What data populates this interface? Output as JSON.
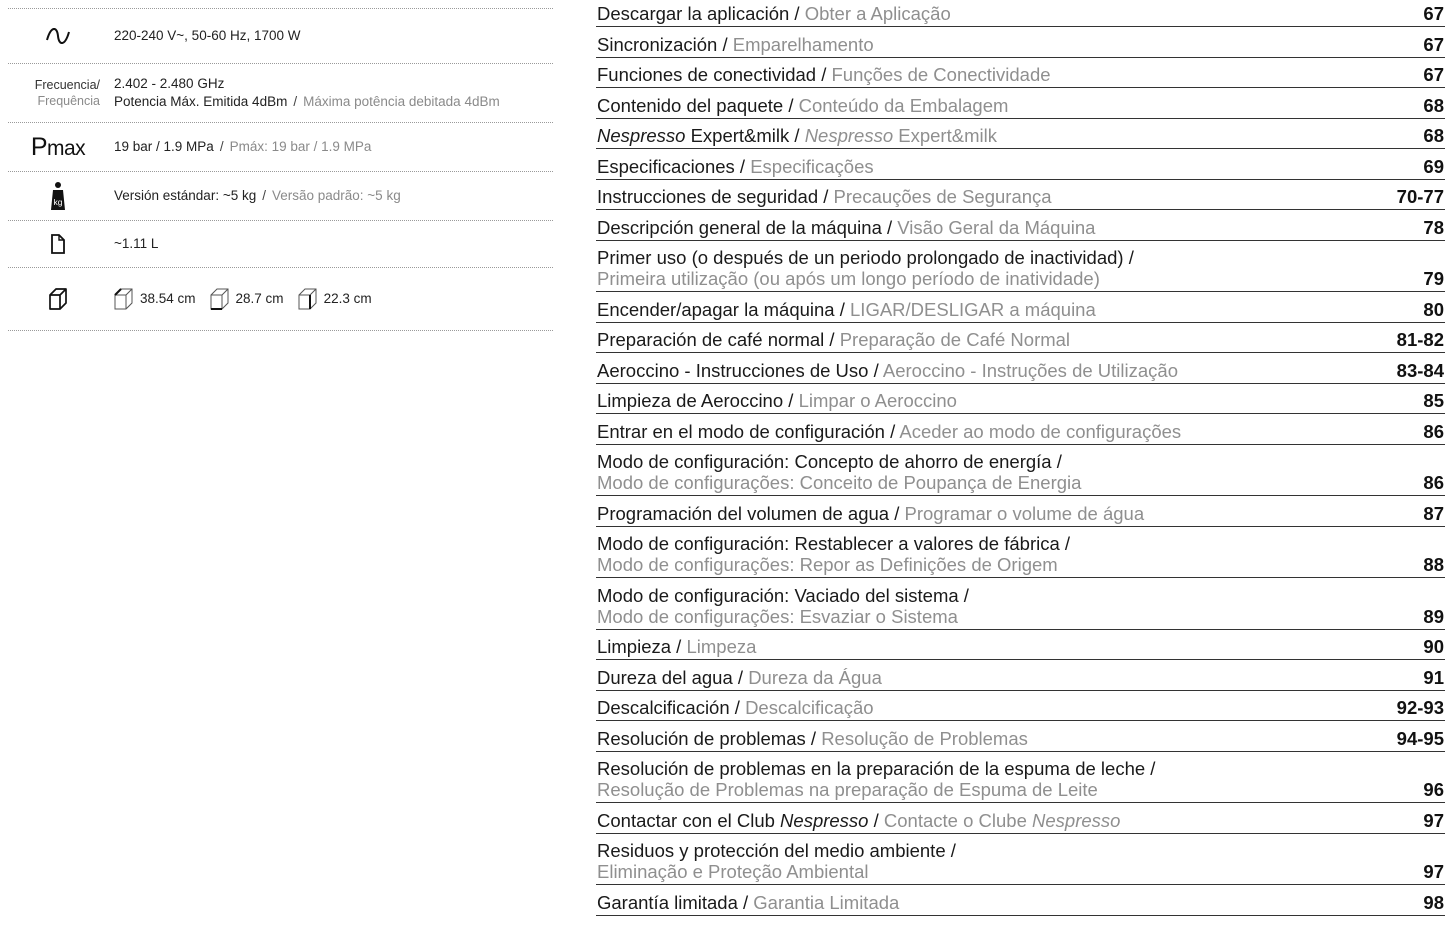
{
  "specs": {
    "voltage": "220-240 V~, 50-60 Hz, 1700 W",
    "frequency_label_es": "Frecuencia/",
    "frequency_label_pt": "Frequência",
    "frequency_value": "2.402 - 2.480 GHz",
    "power_es": "Potencia Máx. Emitida 4dBm",
    "power_pt": "Máxima potência debitada 4dBm",
    "pmax_symbol_p": "P",
    "pmax_symbol_max": "max",
    "pressure_es": "19 bar / 1.9 MPa",
    "pressure_pt": "Pmáx: 19 bar / 1.9 MPa",
    "weight_es": "Versión estándar: ~5 kg",
    "weight_pt": "Versão padrão: ~5 kg",
    "weight_icon_text": "kg",
    "capacity": "~1.11 L",
    "depth": "38.54 cm",
    "width": "28.7 cm",
    "height": "22.3 cm",
    "separator": "/"
  },
  "toc": [
    {
      "es": "Descargar la aplicación",
      "pt": "Obter a Aplicação",
      "page": "67"
    },
    {
      "es": "Sincronización",
      "pt": "Emparelhamento",
      "page": "67"
    },
    {
      "es": "Funciones de conectividad",
      "pt": "Funções de Conectividade",
      "page": "67"
    },
    {
      "es": "Contenido del paquete",
      "pt": "Conteúdo da Embalagem",
      "page": "68"
    },
    {
      "es_brand": "Nespresso",
      "es": " Expert&milk",
      "pt_brand": "Nespresso",
      "pt": " Expert&milk",
      "page": "68"
    },
    {
      "es": "Especificaciones",
      "pt": "Especificações",
      "page": "69"
    },
    {
      "es": "Instrucciones de seguridad",
      "pt": "Precauções de Segurança",
      "page": "70-77"
    },
    {
      "es": "Descripción general de la máquina",
      "pt": "Visão Geral da Máquina",
      "page": "78"
    },
    {
      "es": "Primer uso (o después de un periodo prolongado de inactividad) /",
      "pt": "Primeira utilização (ou após um longo período de inatividade)",
      "page": "79",
      "double": true
    },
    {
      "es": "Encender/apagar la máquina",
      "pt": "LIGAR/DESLIGAR a máquina",
      "page": "80"
    },
    {
      "es": "Preparación de café normal",
      "pt": "Preparação de Café Normal",
      "page": "81-82"
    },
    {
      "es": "Aeroccino - Instrucciones de Uso",
      "pt": "Aeroccino - Instruções de Utilização",
      "page": "83-84"
    },
    {
      "es": "Limpieza de Aeroccino",
      "pt": "Limpar o Aeroccino",
      "page": "85"
    },
    {
      "es": "Entrar en el modo de configuración",
      "pt": "Aceder ao modo de configurações",
      "page": "86"
    },
    {
      "es": "Modo de configuración: Concepto de ahorro de energía /",
      "pt": "Modo de configurações: Conceito de Poupança de Energia",
      "page": "86",
      "double": true
    },
    {
      "es": "Programación del volumen de agua",
      "pt": "Programar o volume de água",
      "page": "87"
    },
    {
      "es": "Modo de configuración: Restablecer a valores de fábrica /",
      "pt": "Modo de configurações: Repor as Definições de Origem",
      "page": "88",
      "double": true
    },
    {
      "es": "Modo de configuración: Vaciado del sistema /",
      "pt": "Modo de configurações: Esvaziar o Sistema",
      "page": "89",
      "double": true
    },
    {
      "es": "Limpieza",
      "pt": "Limpeza",
      "page": "90"
    },
    {
      "es": "Dureza del agua",
      "pt": "Dureza da Água",
      "page": "91"
    },
    {
      "es": "Descalcificación",
      "pt": "Descalcificação",
      "page": "92-93"
    },
    {
      "es": "Resolución de problemas",
      "pt": "Resolução de Problemas",
      "page": "94-95"
    },
    {
      "es": "Resolución de problemas en la preparación de la espuma de leche /",
      "pt": "Resolução de Problemas na preparação de Espuma de Leite",
      "page": "96",
      "double": true
    },
    {
      "es": "Contactar con el Club ",
      "es_brand_after": "Nespresso",
      "pt": "Contacte o Clube ",
      "pt_brand_after": "Nespresso",
      "page": "97"
    },
    {
      "es": "Residuos y protección del medio ambiente /",
      "pt": "Eliminação e Proteção Ambiental",
      "page": "97",
      "double": true
    },
    {
      "es": "Garantía limitada",
      "pt": "Garantia Limitada",
      "page": "98"
    }
  ]
}
